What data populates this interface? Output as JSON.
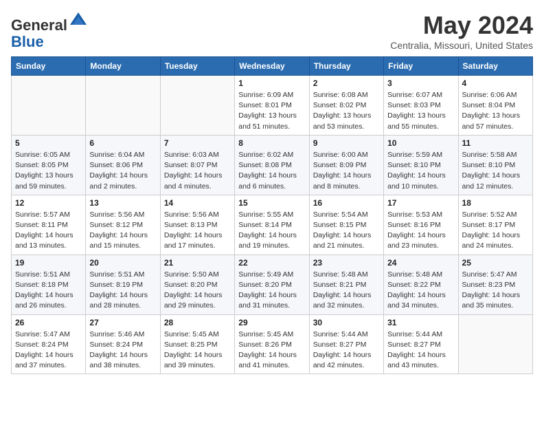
{
  "logo": {
    "general": "General",
    "blue": "Blue"
  },
  "header": {
    "month_year": "May 2024",
    "location": "Centralia, Missouri, United States"
  },
  "days_of_week": [
    "Sunday",
    "Monday",
    "Tuesday",
    "Wednesday",
    "Thursday",
    "Friday",
    "Saturday"
  ],
  "weeks": [
    [
      {
        "day": "",
        "info": ""
      },
      {
        "day": "",
        "info": ""
      },
      {
        "day": "",
        "info": ""
      },
      {
        "day": "1",
        "info": "Sunrise: 6:09 AM\nSunset: 8:01 PM\nDaylight: 13 hours\nand 51 minutes."
      },
      {
        "day": "2",
        "info": "Sunrise: 6:08 AM\nSunset: 8:02 PM\nDaylight: 13 hours\nand 53 minutes."
      },
      {
        "day": "3",
        "info": "Sunrise: 6:07 AM\nSunset: 8:03 PM\nDaylight: 13 hours\nand 55 minutes."
      },
      {
        "day": "4",
        "info": "Sunrise: 6:06 AM\nSunset: 8:04 PM\nDaylight: 13 hours\nand 57 minutes."
      }
    ],
    [
      {
        "day": "5",
        "info": "Sunrise: 6:05 AM\nSunset: 8:05 PM\nDaylight: 13 hours\nand 59 minutes."
      },
      {
        "day": "6",
        "info": "Sunrise: 6:04 AM\nSunset: 8:06 PM\nDaylight: 14 hours\nand 2 minutes."
      },
      {
        "day": "7",
        "info": "Sunrise: 6:03 AM\nSunset: 8:07 PM\nDaylight: 14 hours\nand 4 minutes."
      },
      {
        "day": "8",
        "info": "Sunrise: 6:02 AM\nSunset: 8:08 PM\nDaylight: 14 hours\nand 6 minutes."
      },
      {
        "day": "9",
        "info": "Sunrise: 6:00 AM\nSunset: 8:09 PM\nDaylight: 14 hours\nand 8 minutes."
      },
      {
        "day": "10",
        "info": "Sunrise: 5:59 AM\nSunset: 8:10 PM\nDaylight: 14 hours\nand 10 minutes."
      },
      {
        "day": "11",
        "info": "Sunrise: 5:58 AM\nSunset: 8:10 PM\nDaylight: 14 hours\nand 12 minutes."
      }
    ],
    [
      {
        "day": "12",
        "info": "Sunrise: 5:57 AM\nSunset: 8:11 PM\nDaylight: 14 hours\nand 13 minutes."
      },
      {
        "day": "13",
        "info": "Sunrise: 5:56 AM\nSunset: 8:12 PM\nDaylight: 14 hours\nand 15 minutes."
      },
      {
        "day": "14",
        "info": "Sunrise: 5:56 AM\nSunset: 8:13 PM\nDaylight: 14 hours\nand 17 minutes."
      },
      {
        "day": "15",
        "info": "Sunrise: 5:55 AM\nSunset: 8:14 PM\nDaylight: 14 hours\nand 19 minutes."
      },
      {
        "day": "16",
        "info": "Sunrise: 5:54 AM\nSunset: 8:15 PM\nDaylight: 14 hours\nand 21 minutes."
      },
      {
        "day": "17",
        "info": "Sunrise: 5:53 AM\nSunset: 8:16 PM\nDaylight: 14 hours\nand 23 minutes."
      },
      {
        "day": "18",
        "info": "Sunrise: 5:52 AM\nSunset: 8:17 PM\nDaylight: 14 hours\nand 24 minutes."
      }
    ],
    [
      {
        "day": "19",
        "info": "Sunrise: 5:51 AM\nSunset: 8:18 PM\nDaylight: 14 hours\nand 26 minutes."
      },
      {
        "day": "20",
        "info": "Sunrise: 5:51 AM\nSunset: 8:19 PM\nDaylight: 14 hours\nand 28 minutes."
      },
      {
        "day": "21",
        "info": "Sunrise: 5:50 AM\nSunset: 8:20 PM\nDaylight: 14 hours\nand 29 minutes."
      },
      {
        "day": "22",
        "info": "Sunrise: 5:49 AM\nSunset: 8:20 PM\nDaylight: 14 hours\nand 31 minutes."
      },
      {
        "day": "23",
        "info": "Sunrise: 5:48 AM\nSunset: 8:21 PM\nDaylight: 14 hours\nand 32 minutes."
      },
      {
        "day": "24",
        "info": "Sunrise: 5:48 AM\nSunset: 8:22 PM\nDaylight: 14 hours\nand 34 minutes."
      },
      {
        "day": "25",
        "info": "Sunrise: 5:47 AM\nSunset: 8:23 PM\nDaylight: 14 hours\nand 35 minutes."
      }
    ],
    [
      {
        "day": "26",
        "info": "Sunrise: 5:47 AM\nSunset: 8:24 PM\nDaylight: 14 hours\nand 37 minutes."
      },
      {
        "day": "27",
        "info": "Sunrise: 5:46 AM\nSunset: 8:24 PM\nDaylight: 14 hours\nand 38 minutes."
      },
      {
        "day": "28",
        "info": "Sunrise: 5:45 AM\nSunset: 8:25 PM\nDaylight: 14 hours\nand 39 minutes."
      },
      {
        "day": "29",
        "info": "Sunrise: 5:45 AM\nSunset: 8:26 PM\nDaylight: 14 hours\nand 41 minutes."
      },
      {
        "day": "30",
        "info": "Sunrise: 5:44 AM\nSunset: 8:27 PM\nDaylight: 14 hours\nand 42 minutes."
      },
      {
        "day": "31",
        "info": "Sunrise: 5:44 AM\nSunset: 8:27 PM\nDaylight: 14 hours\nand 43 minutes."
      },
      {
        "day": "",
        "info": ""
      }
    ]
  ]
}
